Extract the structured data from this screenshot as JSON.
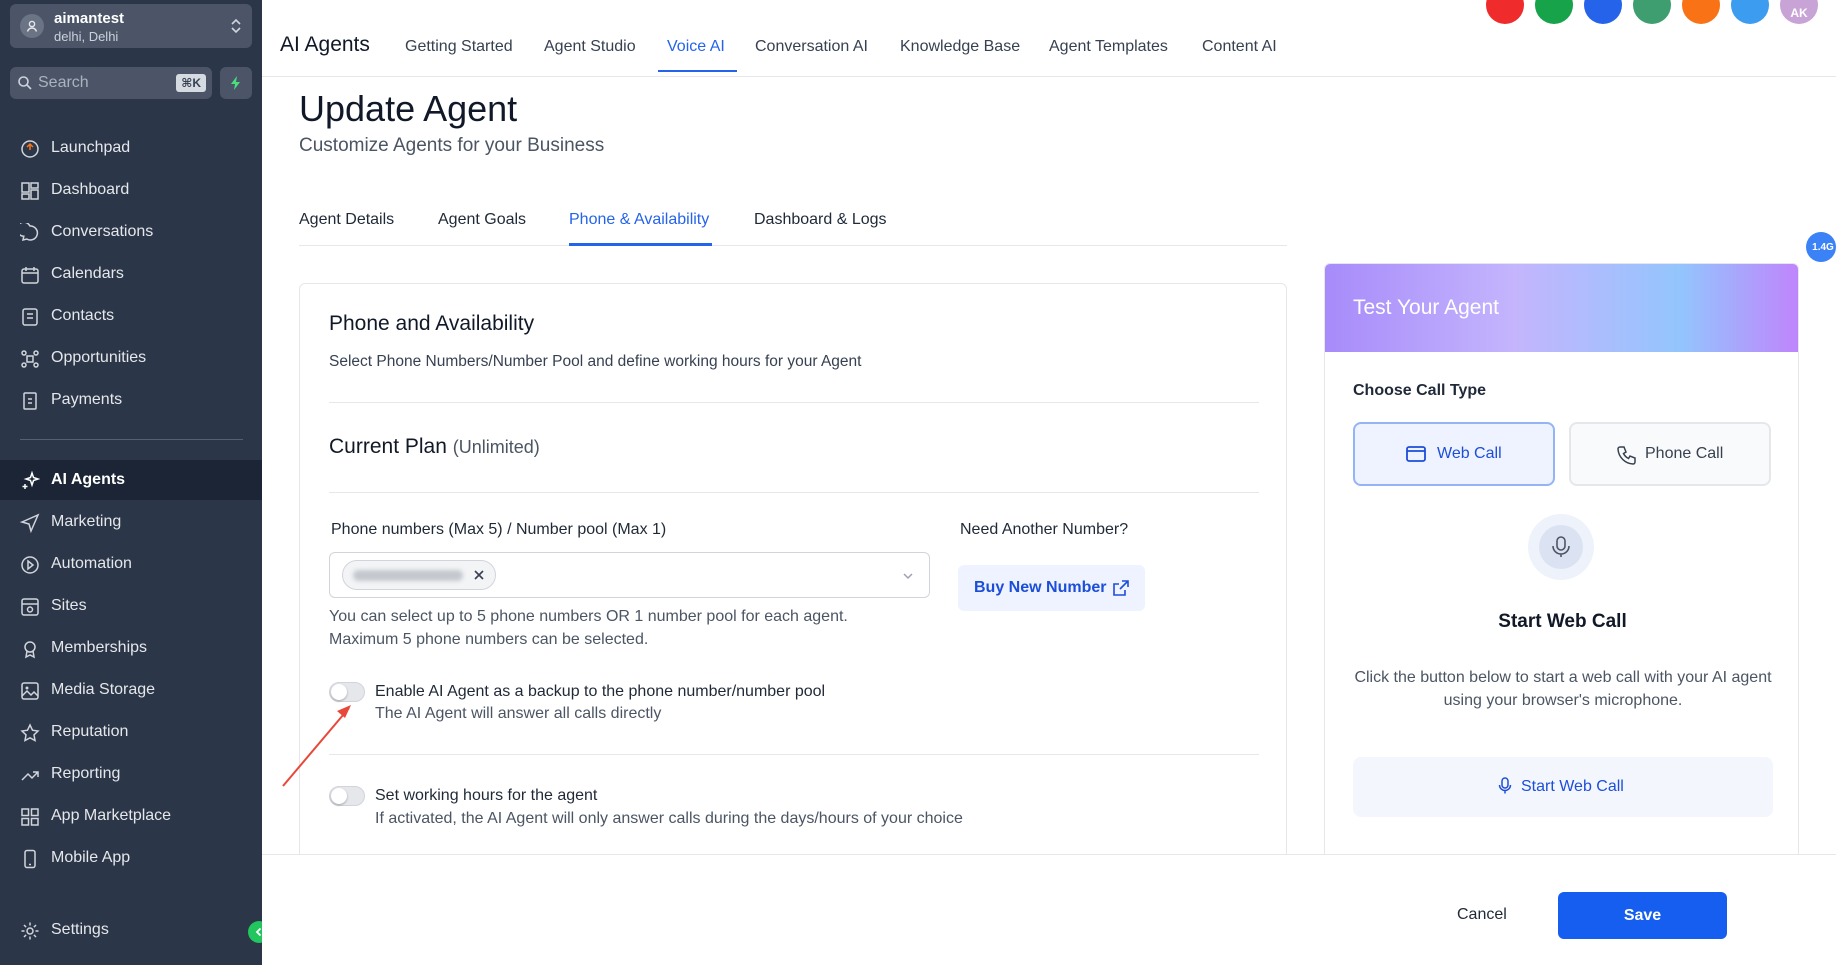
{
  "account": {
    "name": "aimantest",
    "location": "delhi, Delhi"
  },
  "search": {
    "placeholder": "Search",
    "shortcut": "⌘K"
  },
  "sidebar": {
    "items": [
      {
        "label": "Launchpad",
        "icon": "launchpad-icon"
      },
      {
        "label": "Dashboard",
        "icon": "dashboard-icon"
      },
      {
        "label": "Conversations",
        "icon": "chat-icon"
      },
      {
        "label": "Calendars",
        "icon": "calendar-icon"
      },
      {
        "label": "Contacts",
        "icon": "contacts-icon"
      },
      {
        "label": "Opportunities",
        "icon": "opportunities-icon"
      },
      {
        "label": "Payments",
        "icon": "payments-icon"
      },
      {
        "label": "AI Agents",
        "icon": "sparkle-icon",
        "active": true
      },
      {
        "label": "Marketing",
        "icon": "send-icon"
      },
      {
        "label": "Automation",
        "icon": "automation-icon"
      },
      {
        "label": "Sites",
        "icon": "sites-icon"
      },
      {
        "label": "Memberships",
        "icon": "memberships-icon"
      },
      {
        "label": "Media Storage",
        "icon": "image-icon"
      },
      {
        "label": "Reputation",
        "icon": "star-icon"
      },
      {
        "label": "Reporting",
        "icon": "trend-icon"
      },
      {
        "label": "App Marketplace",
        "icon": "grid-icon"
      },
      {
        "label": "Mobile App",
        "icon": "mobile-icon"
      }
    ],
    "settings": "Settings"
  },
  "header": {
    "title": "AI Agents",
    "tabs": [
      "Getting Started",
      "Agent Studio",
      "Voice AI",
      "Conversation AI",
      "Knowledge Base",
      "Agent Templates",
      "Content AI"
    ],
    "active_tab": "Voice AI",
    "avatar_initials": "AK"
  },
  "page": {
    "title": "Update Agent",
    "subtitle": "Customize Agents for your Business",
    "tabs": [
      "Agent Details",
      "Agent Goals",
      "Phone & Availability",
      "Dashboard & Logs"
    ],
    "active_tab": "Phone & Availability",
    "version_badge": "1.4G"
  },
  "phone_card": {
    "title": "Phone and Availability",
    "description": "Select Phone Numbers/Number Pool and define working hours for your Agent",
    "plan_label": "Current Plan",
    "plan_value": "(Unlimited)",
    "field_label": "Phone numbers (Max 5) / Number pool (Max 1)",
    "need_label": "Need Another Number?",
    "buy_button": "Buy New Number",
    "hint_1": "You can select up to 5 phone numbers OR 1 number pool for each agent.",
    "hint_2": "Maximum 5 phone numbers can be selected.",
    "backup_toggle": {
      "title": "Enable AI Agent as a backup to the phone number/number pool",
      "subtitle": "The AI Agent will answer all calls directly",
      "enabled": false
    },
    "hours_toggle": {
      "title": "Set working hours for the agent",
      "subtitle": "If activated, the AI Agent will only answer calls during the days/hours of your choice",
      "enabled": false
    }
  },
  "test_panel": {
    "title": "Test Your Agent",
    "call_type_label": "Choose Call Type",
    "web_call": "Web Call",
    "phone_call": "Phone Call",
    "start_title": "Start Web Call",
    "start_desc": "Click the button below to start a web call with your AI agent using your browser's microphone.",
    "start_button": "Start Web Call"
  },
  "footer": {
    "cancel": "Cancel",
    "save": "Save"
  },
  "colors": {
    "accent": "#155eef",
    "sidebar_bg": "#2b3648"
  }
}
